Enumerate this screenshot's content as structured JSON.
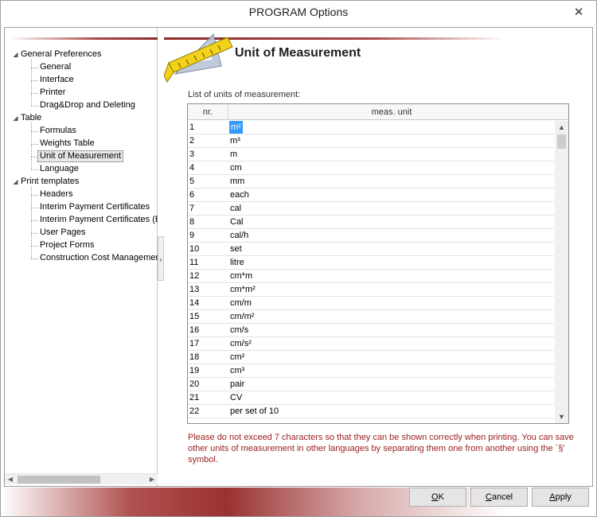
{
  "window": {
    "title": "PROGRAM Options",
    "close_glyph": "✕"
  },
  "tree": {
    "items": [
      {
        "label": "General Preferences",
        "level": 0,
        "expander": "◢"
      },
      {
        "label": "General",
        "level": 1
      },
      {
        "label": "Interface",
        "level": 1
      },
      {
        "label": "Printer",
        "level": 1
      },
      {
        "label": "Drag&Drop and Deleting",
        "level": 1
      },
      {
        "label": "Table",
        "level": 0,
        "expander": "◢"
      },
      {
        "label": "Formulas",
        "level": 1
      },
      {
        "label": "Weights Table",
        "level": 1
      },
      {
        "label": "Unit of Measurement",
        "level": 1,
        "selected": true
      },
      {
        "label": "Language",
        "level": 1
      },
      {
        "label": "Print templates",
        "level": 0,
        "expander": "◢"
      },
      {
        "label": "Headers",
        "level": 1
      },
      {
        "label": "Interim Payment Certificates",
        "level": 1
      },
      {
        "label": "Interim Payment Certificates (E",
        "level": 1
      },
      {
        "label": "User Pages",
        "level": 1
      },
      {
        "label": "Project Forms",
        "level": 1
      },
      {
        "label": "Construction Cost Managemen",
        "level": 1
      }
    ],
    "scroll_left_glyph": "◀",
    "scroll_right_glyph": "▶"
  },
  "splitter": {
    "glyph": "‹"
  },
  "page": {
    "title": "Unit of Measurement",
    "list_caption": "List of units of measurement:",
    "icon": "ruler-triangle-icon"
  },
  "grid": {
    "col_nr": "nr.",
    "col_unit": "meas. unit",
    "rows": [
      {
        "nr": "1",
        "unit": "m²",
        "selected": true
      },
      {
        "nr": "2",
        "unit": "m³"
      },
      {
        "nr": "3",
        "unit": "m"
      },
      {
        "nr": "4",
        "unit": "cm"
      },
      {
        "nr": "5",
        "unit": "mm"
      },
      {
        "nr": "6",
        "unit": "each"
      },
      {
        "nr": "7",
        "unit": "cal"
      },
      {
        "nr": "8",
        "unit": "Cal"
      },
      {
        "nr": "9",
        "unit": "cal/h"
      },
      {
        "nr": "10",
        "unit": "set"
      },
      {
        "nr": "11",
        "unit": "litre"
      },
      {
        "nr": "12",
        "unit": "cm*m"
      },
      {
        "nr": "13",
        "unit": "cm*m²"
      },
      {
        "nr": "14",
        "unit": "cm/m"
      },
      {
        "nr": "15",
        "unit": "cm/m²"
      },
      {
        "nr": "16",
        "unit": "cm/s"
      },
      {
        "nr": "17",
        "unit": "cm/s²"
      },
      {
        "nr": "18",
        "unit": "cm²"
      },
      {
        "nr": "19",
        "unit": "cm³"
      },
      {
        "nr": "20",
        "unit": "pair"
      },
      {
        "nr": "21",
        "unit": "CV"
      },
      {
        "nr": "22",
        "unit": "per set of 10"
      }
    ],
    "scroll_up_glyph": "▲",
    "scroll_down_glyph": "▼"
  },
  "note": "Please do not exceed 7 characters so that they can be shown correctly when printing. You can save other units of measurement in other languages by separating them one from another using the `§' symbol.",
  "buttons": {
    "ok": {
      "mnemonic": "O",
      "rest": "K"
    },
    "cancel": {
      "mnemonic": "C",
      "rest": "ancel"
    },
    "apply": {
      "mnemonic": "A",
      "rest": "pply"
    }
  },
  "colors": {
    "accent_dark_red": "#9a3232",
    "note_text": "#9b1c1c",
    "selection_blue": "#3399ff"
  }
}
